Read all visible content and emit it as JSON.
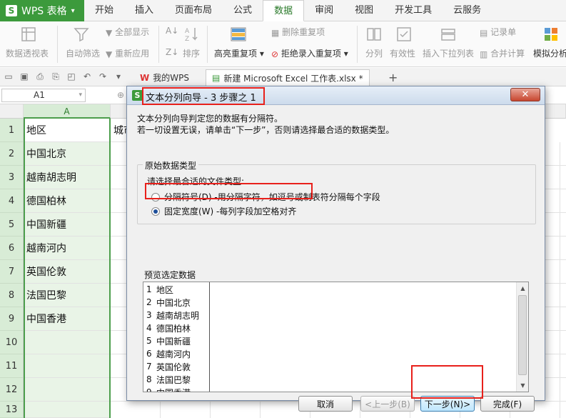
{
  "app": {
    "name": "WPS 表格",
    "logo": "S"
  },
  "menu_tabs": [
    {
      "label": "开始"
    },
    {
      "label": "插入"
    },
    {
      "label": "页面布局"
    },
    {
      "label": "公式"
    },
    {
      "label": "数据"
    },
    {
      "label": "审阅"
    },
    {
      "label": "视图"
    },
    {
      "label": "开发工具"
    },
    {
      "label": "云服务"
    }
  ],
  "active_tab": "数据",
  "ribbon": {
    "pivot": "数据透视表",
    "autofilter": "自动筛选",
    "show_all": "全部显示",
    "reapply": "重新应用",
    "sort": "排序",
    "highlight_dup": "高亮重复项",
    "remove_dup": "删除重复项",
    "reject_dup": "拒绝录入重复项",
    "split": "分列",
    "validity": "有效性",
    "insert_dropdown": "插入下拉列表",
    "record_sheet": "记录单",
    "consolidate": "合并计算",
    "simulate": "模拟分析"
  },
  "doc_tabs": {
    "wps": "我的WPS",
    "file": "新建 Microsoft Excel 工作表.xlsx *",
    "add": "+"
  },
  "namebox": "A1",
  "columns": [
    {
      "label": "A"
    }
  ],
  "rows": [
    {
      "num": "1",
      "a": "地区"
    },
    {
      "num": "2",
      "a": "中国北京"
    },
    {
      "num": "3",
      "a": "越南胡志明"
    },
    {
      "num": "4",
      "a": "德国柏林"
    },
    {
      "num": "5",
      "a": "中国新疆"
    },
    {
      "num": "6",
      "a": "越南河内"
    },
    {
      "num": "7",
      "a": "英国伦敦"
    },
    {
      "num": "8",
      "a": "法国巴黎"
    },
    {
      "num": "9",
      "a": "中国香港"
    },
    {
      "num": "10",
      "a": ""
    },
    {
      "num": "11",
      "a": ""
    },
    {
      "num": "12",
      "a": ""
    },
    {
      "num": "13",
      "a": ""
    }
  ],
  "b1_partial": "城市",
  "dialog": {
    "title": "文本分列向导 - 3 步骤之 1",
    "close": "✕",
    "desc1": "文本分列向导判定您的数据有分隔符。",
    "desc2": "若一切设置无误，请单击“下一步”，否则请选择最合适的数据类型。",
    "group_title": "原始数据类型",
    "prompt": "请选择最合适的文件类型:",
    "option_delimited": "分隔符号(D) -用分隔字符，如逗号或制表符分隔每个字段",
    "option_fixed": "固定宽度(W) -每列字段加空格对齐",
    "selected_option": "fixed",
    "preview_label": "预览选定数据",
    "preview_rows": [
      {
        "n": "1",
        "text": "地区"
      },
      {
        "n": "2",
        "text": "中国北京"
      },
      {
        "n": "3",
        "text": "越南胡志明"
      },
      {
        "n": "4",
        "text": "德国柏林"
      },
      {
        "n": "5",
        "text": "中国新疆"
      },
      {
        "n": "6",
        "text": "越南河内"
      },
      {
        "n": "7",
        "text": "英国伦敦"
      },
      {
        "n": "8",
        "text": "法国巴黎"
      },
      {
        "n": "9",
        "text": "中国香港"
      }
    ],
    "buttons": {
      "cancel": "取消",
      "back": "<上一步(B)",
      "next": "下一步(N)>",
      "finish": "完成(F)"
    }
  },
  "colors": {
    "brand": "#3c9a3c",
    "highlight": "#e8201b",
    "selection": "#e9f4e7"
  }
}
